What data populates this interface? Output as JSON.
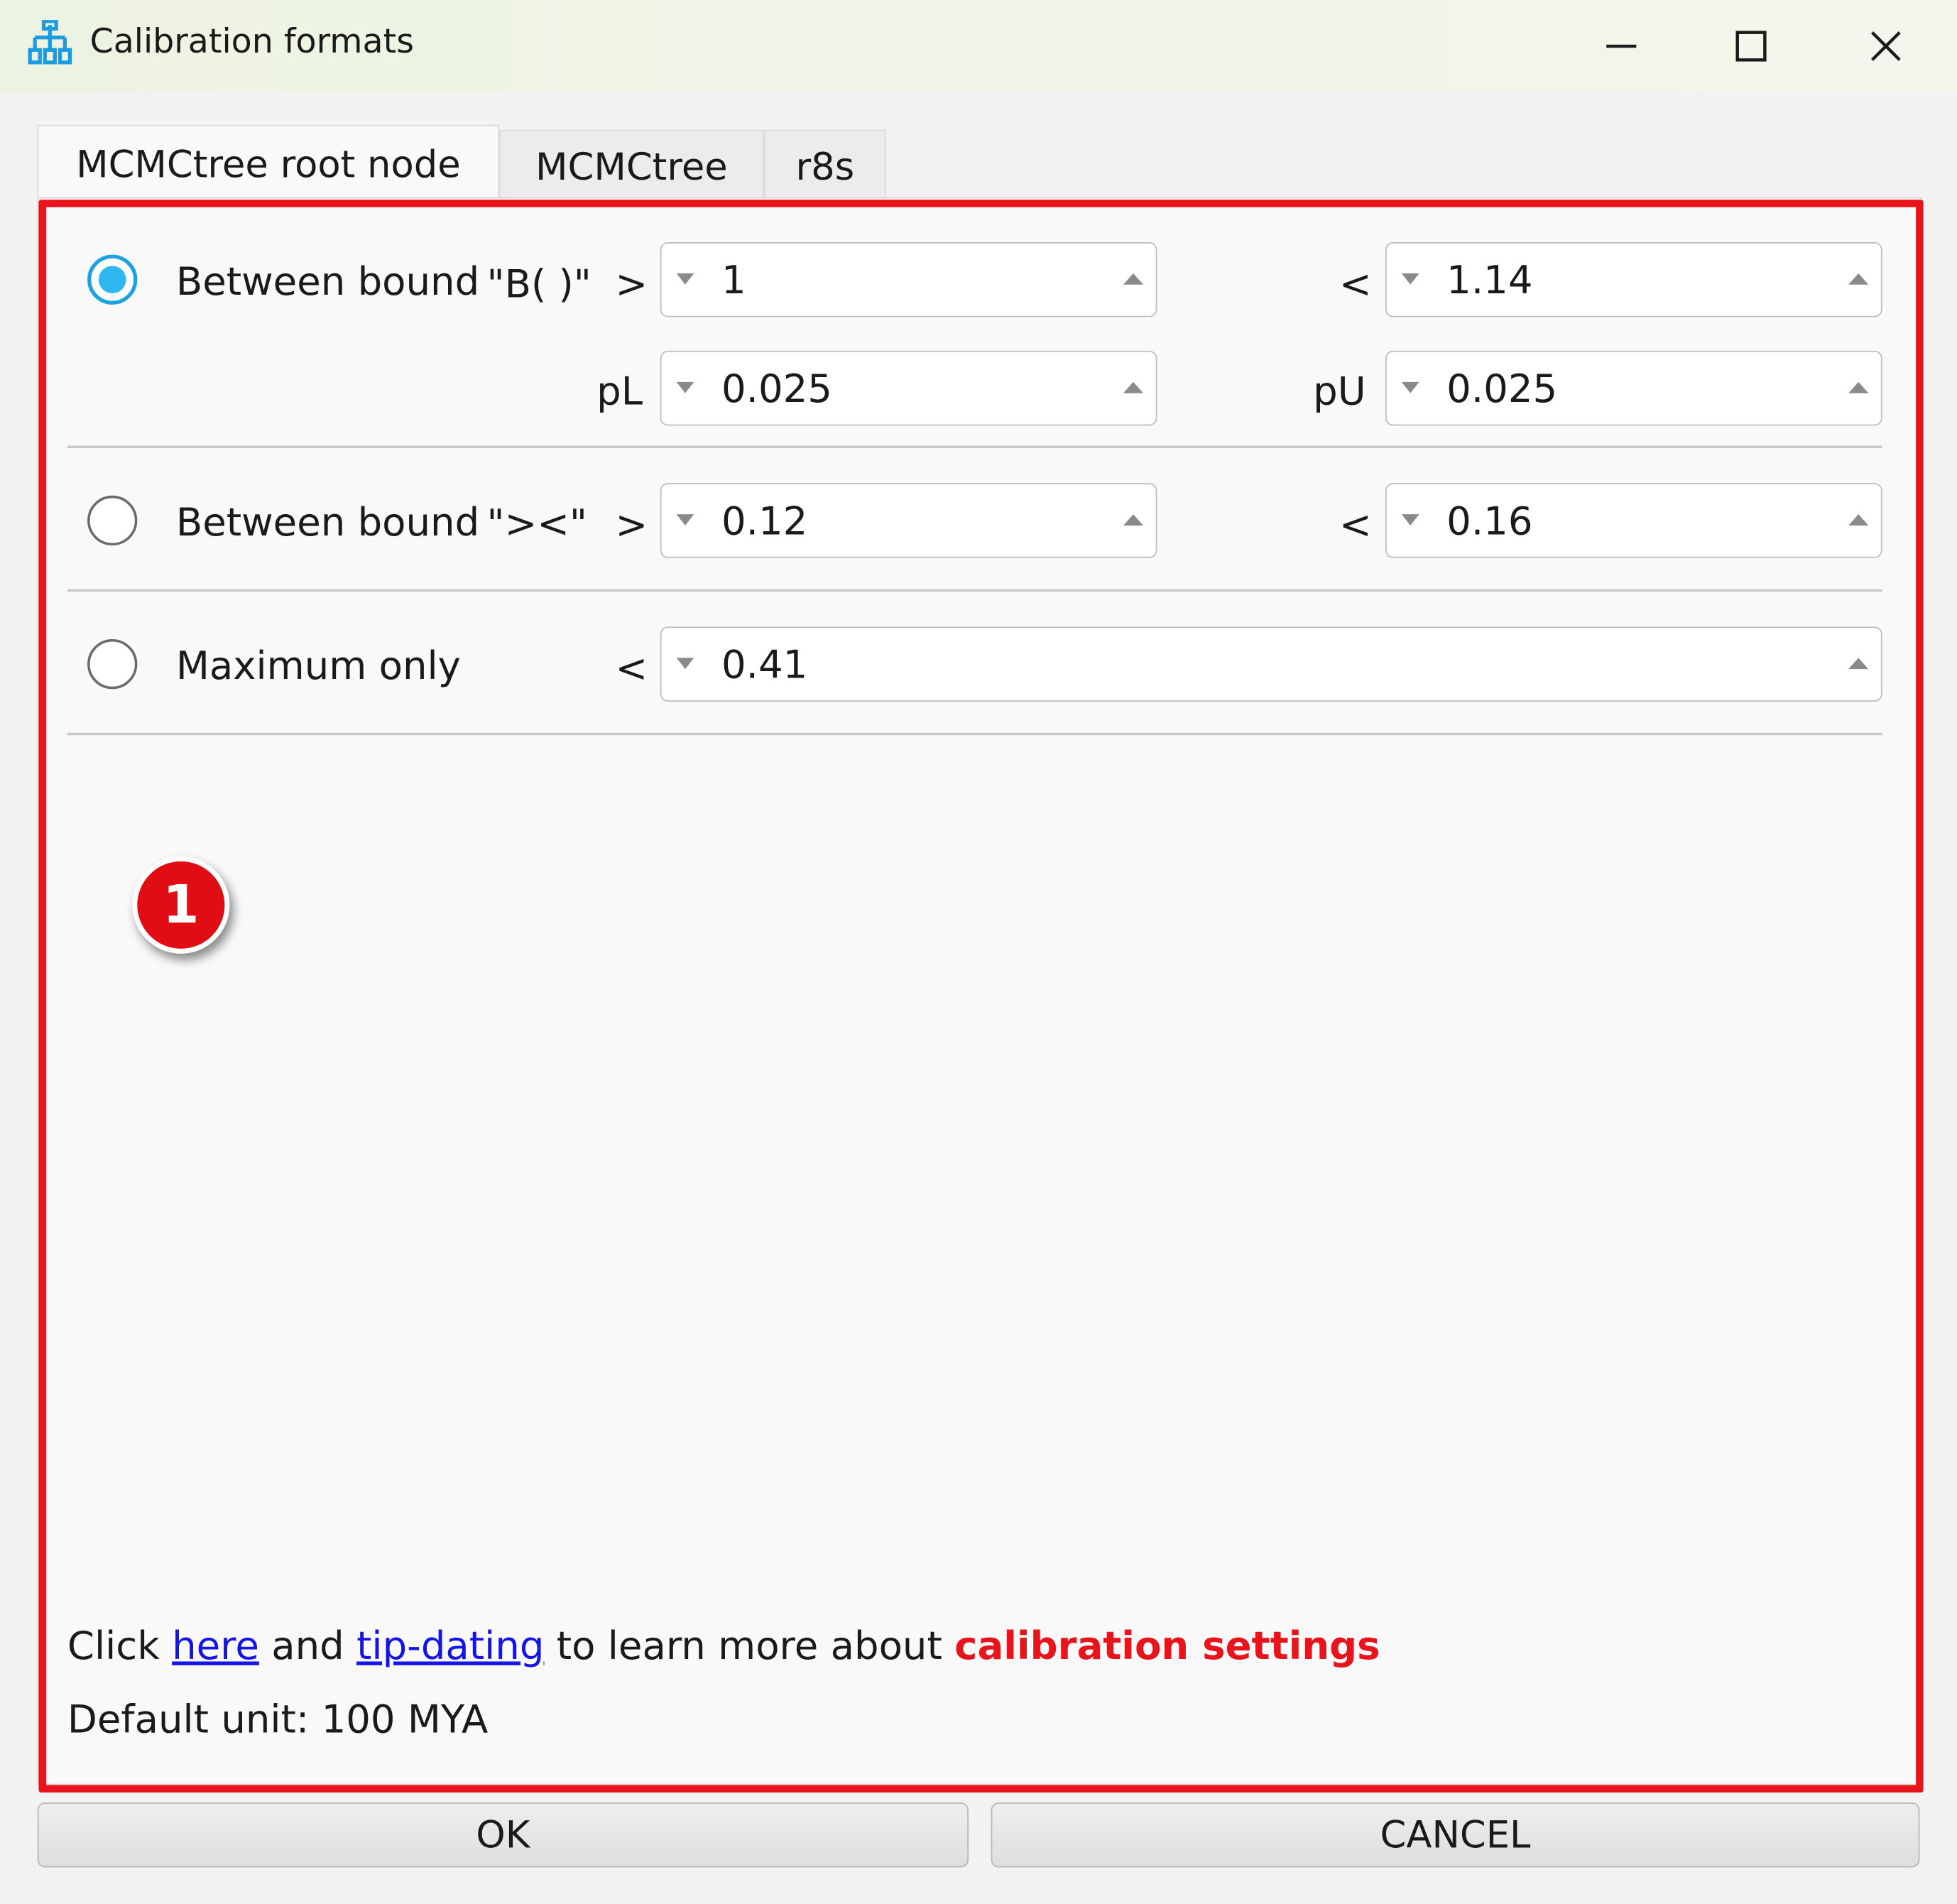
{
  "window": {
    "title": "Calibration formats",
    "controls": {
      "minimize": "minimize",
      "maximize": "maximize",
      "close": "close"
    }
  },
  "tabs": [
    {
      "label": "MCMCtree root node",
      "active": true
    },
    {
      "label": "MCMCtree",
      "active": false
    },
    {
      "label": "r8s",
      "active": false
    }
  ],
  "options": {
    "between_B": {
      "label": "Between bound",
      "format": "\"B( )\"",
      "selected": true,
      "gt_symbol": ">",
      "lower": "1",
      "lt_symbol": "<",
      "upper": "1.14",
      "pL_label": "pL",
      "pL": "0.025",
      "pU_label": "pU",
      "pU": "0.025"
    },
    "between_gtlt": {
      "label": "Between bound",
      "format": "\"><\"",
      "selected": false,
      "gt_symbol": ">",
      "lower": "0.12",
      "lt_symbol": "<",
      "upper": "0.16"
    },
    "maximum": {
      "label": "Maximum only",
      "selected": false,
      "lt_symbol": "<",
      "value": "0.41"
    }
  },
  "annotation_badge": "1",
  "info": {
    "click": "Click",
    "here_link": "here",
    "and": "and",
    "tip_link": "tip-dating",
    "learn": "to learn more about",
    "emphasis": "calibration settings",
    "default_unit": "Default unit: 100 MYA"
  },
  "buttons": {
    "ok": "OK",
    "cancel": "CANCEL"
  },
  "colors": {
    "accent": "#2fb8f0",
    "highlight": "#e8141b",
    "link": "#1414e6"
  }
}
